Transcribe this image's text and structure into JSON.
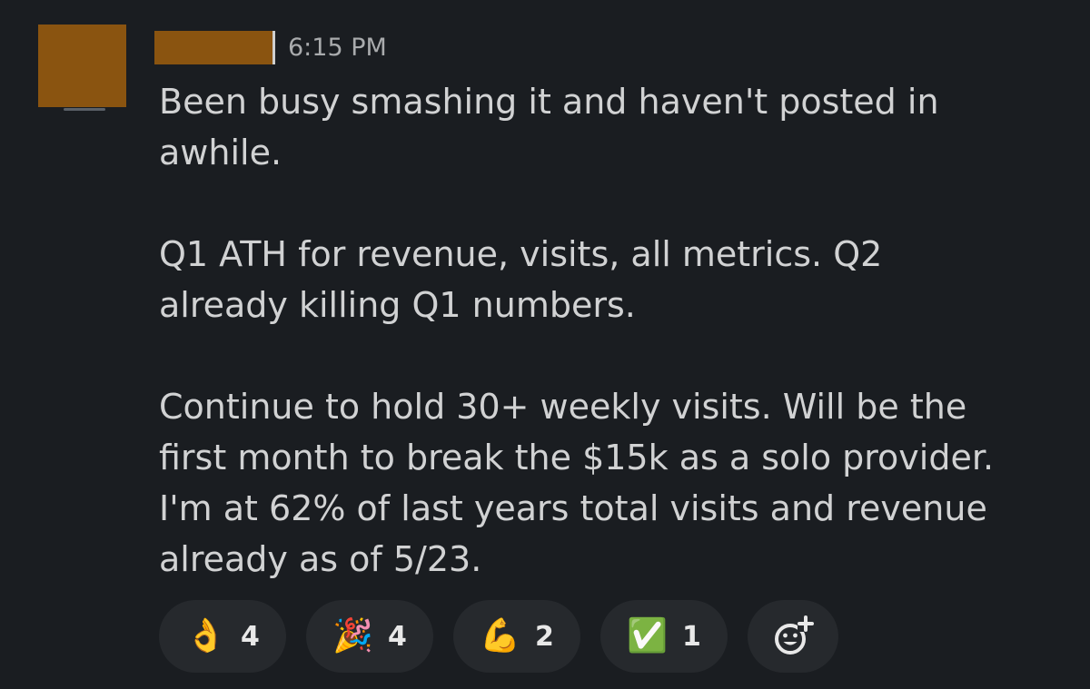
{
  "message": {
    "timestamp": "6:15 PM",
    "paragraphs": [
      "Been busy smashing it and haven't posted in\nawhile.",
      "Q1 ATH for revenue, visits, all metrics. Q2\nalready killing Q1 numbers.",
      "Continue to hold 30+ weekly visits. Will be the\nfirst month to break the $15k as a solo provider.\nI'm at 62% of last years total visits and revenue\nalready as of 5/23."
    ]
  },
  "reactions": [
    {
      "emoji": "👌",
      "icon": "ok-hand-icon",
      "count": "4"
    },
    {
      "emoji": "🎉",
      "icon": "party-popper-icon",
      "count": "4"
    },
    {
      "emoji": "💪",
      "icon": "flexed-biceps-icon",
      "count": "2"
    },
    {
      "emoji": "✅",
      "icon": "check-mark-icon",
      "count": "1"
    }
  ],
  "add_reaction": {
    "icon": "add-reaction-icon"
  },
  "colors": {
    "background": "#1a1d21",
    "text": "#d1d2d3",
    "timestamp": "#a9abad",
    "pill": "#26292d",
    "redaction": "#8a5410"
  }
}
